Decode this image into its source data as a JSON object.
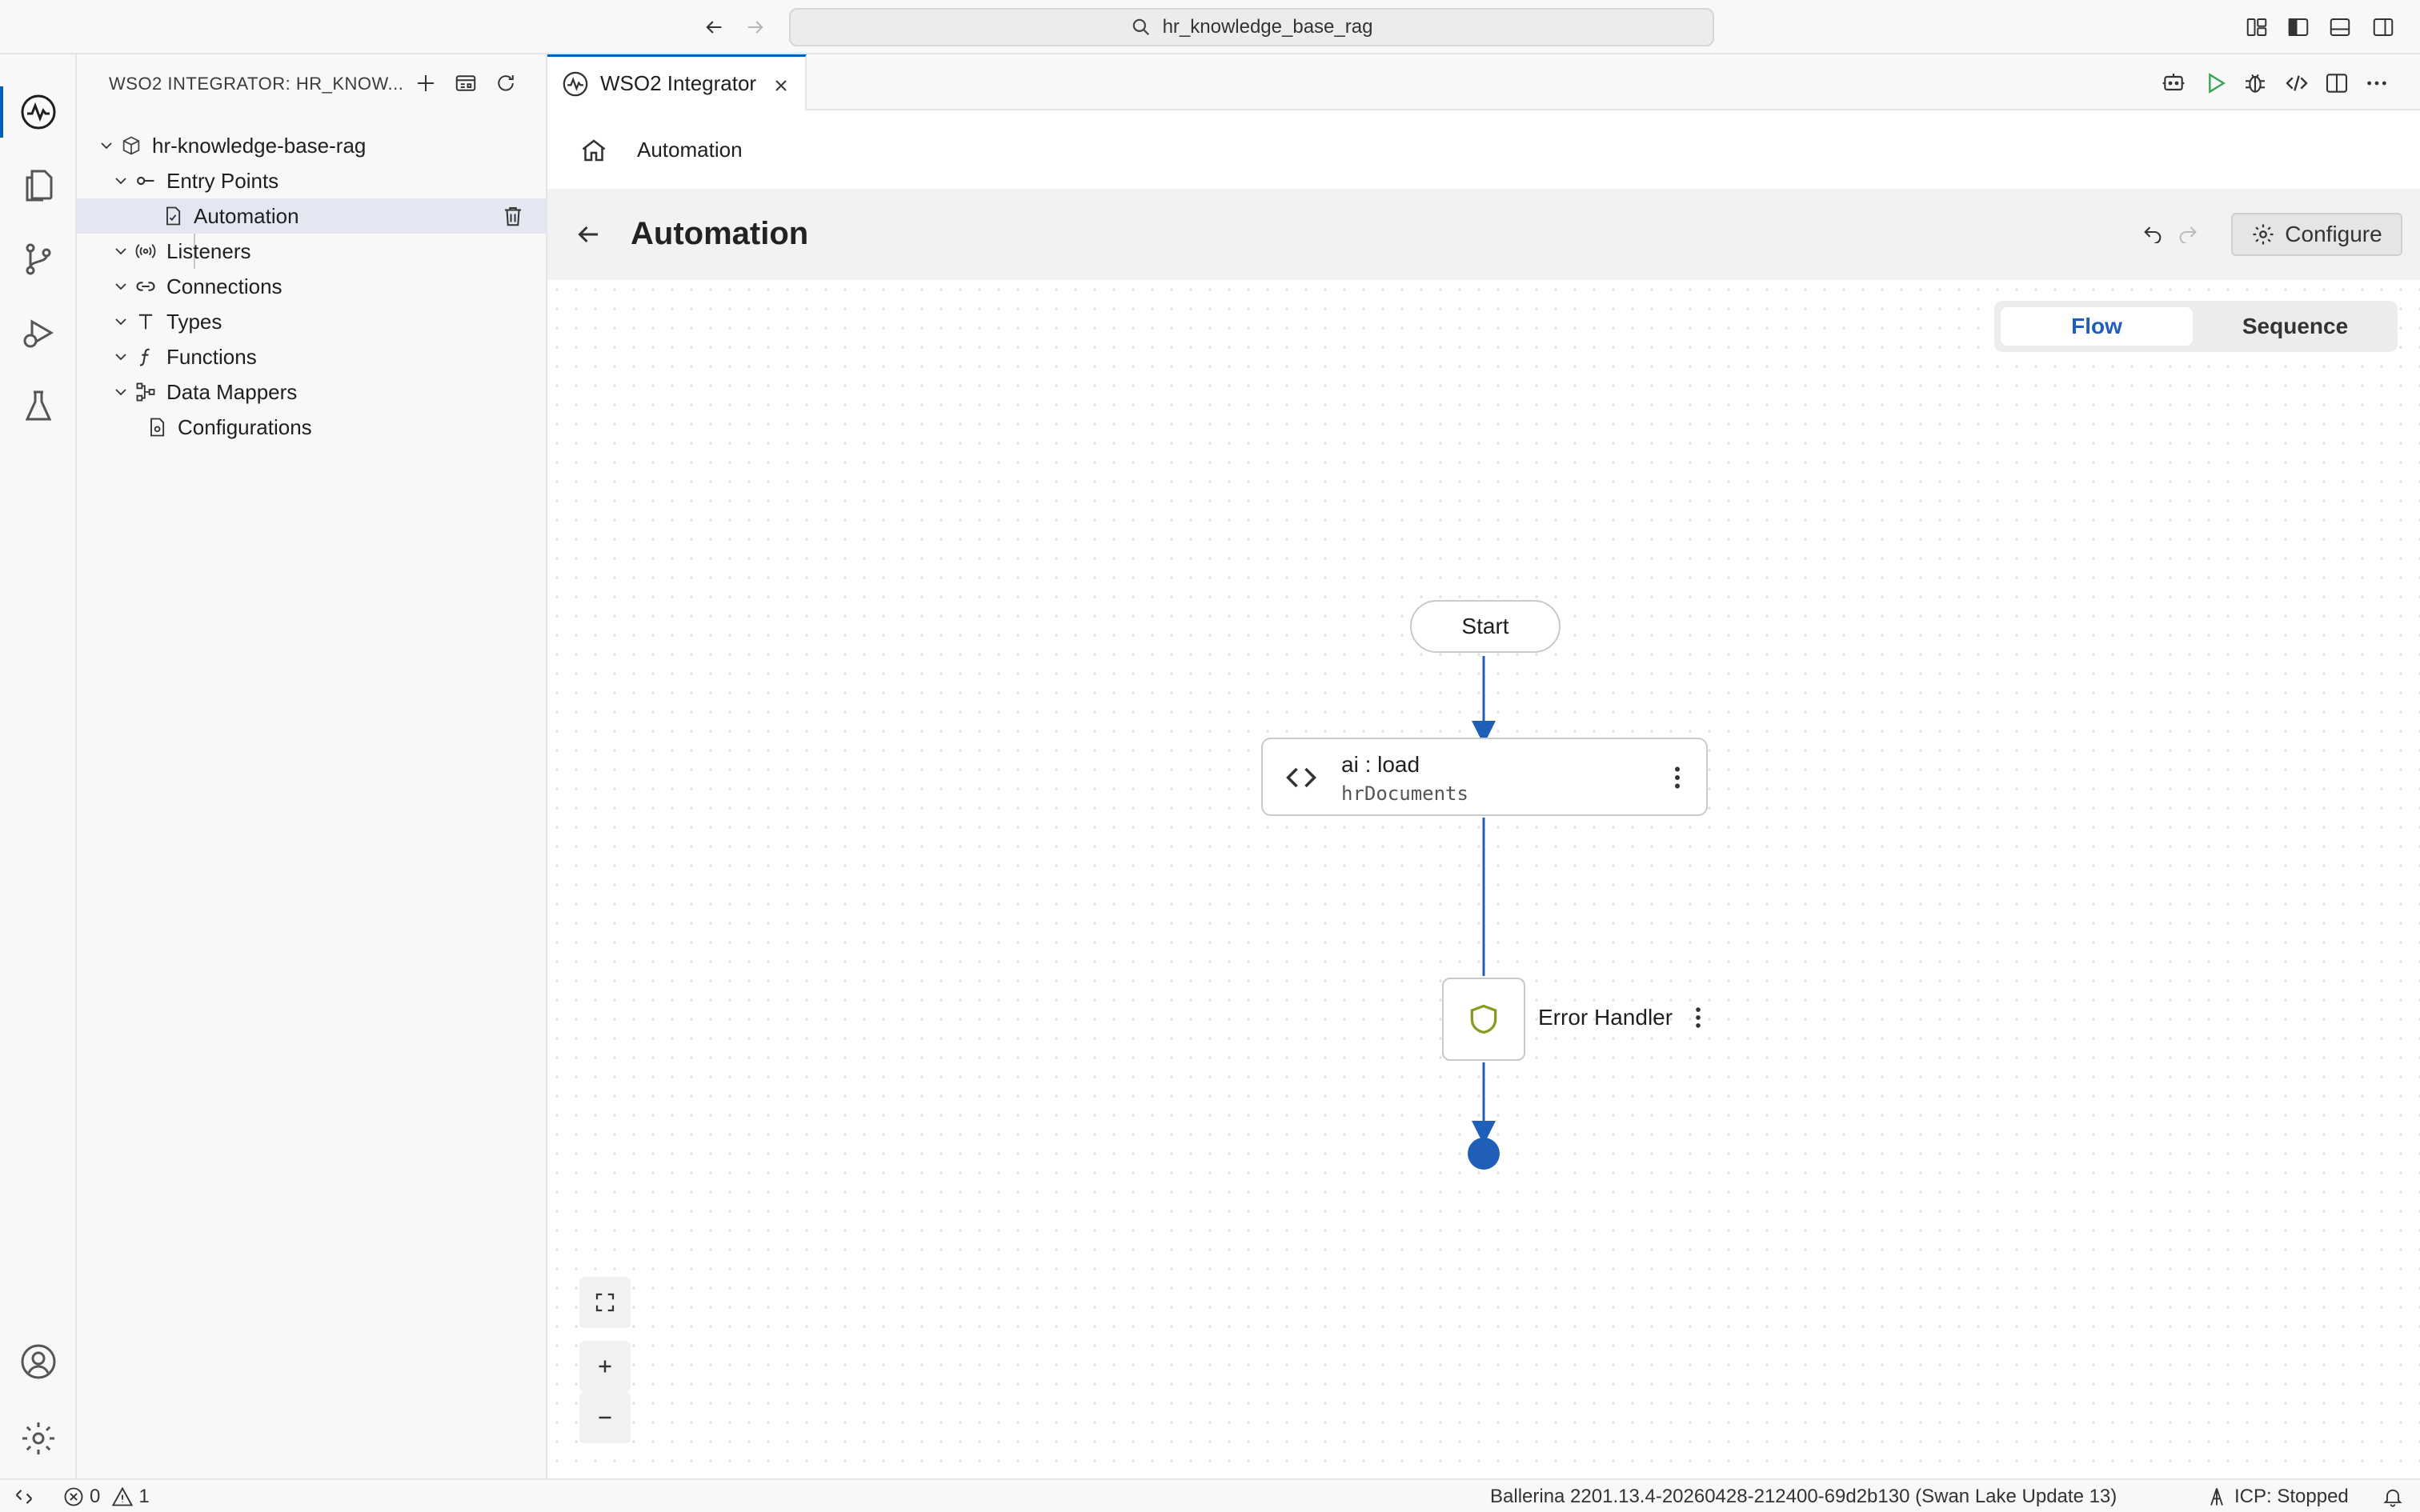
{
  "titlebar": {
    "search_text": "hr_knowledge_base_rag"
  },
  "sidebar": {
    "title": "WSO2 INTEGRATOR: HR_KNOW...",
    "project": "hr-knowledge-base-rag",
    "items": [
      {
        "label": "Entry Points",
        "icon": "entry-points-icon"
      },
      {
        "label": "Automation",
        "icon": "file-code-icon"
      },
      {
        "label": "Listeners",
        "icon": "broadcast-icon"
      },
      {
        "label": "Connections",
        "icon": "link-icon"
      },
      {
        "label": "Types",
        "icon": "type-icon"
      },
      {
        "label": "Functions",
        "icon": "function-icon"
      },
      {
        "label": "Data Mappers",
        "icon": "data-mapper-icon"
      },
      {
        "label": "Configurations",
        "icon": "settings-file-icon"
      }
    ]
  },
  "editor": {
    "tab_label": "WSO2 Integrator"
  },
  "breadcrumb": {
    "current": "Automation"
  },
  "header": {
    "title": "Automation",
    "configure_label": "Configure"
  },
  "view_toggle": {
    "options": [
      "Flow",
      "Sequence"
    ],
    "selected": "Flow"
  },
  "flow": {
    "start_label": "Start",
    "node": {
      "title": "ai : load",
      "subtitle": "hrDocuments"
    },
    "error_handler_label": "Error Handler"
  },
  "statusbar": {
    "errors": "0",
    "warnings": "1",
    "ballerina_version": "Ballerina 2201.13.4-20260428-212400-69d2b130 (Swan Lake Update 13)",
    "icp_status": "ICP: Stopped"
  },
  "colors": {
    "accent": "#1f5fb8",
    "shield": "#8a9a1f",
    "run": "#3aa655"
  }
}
